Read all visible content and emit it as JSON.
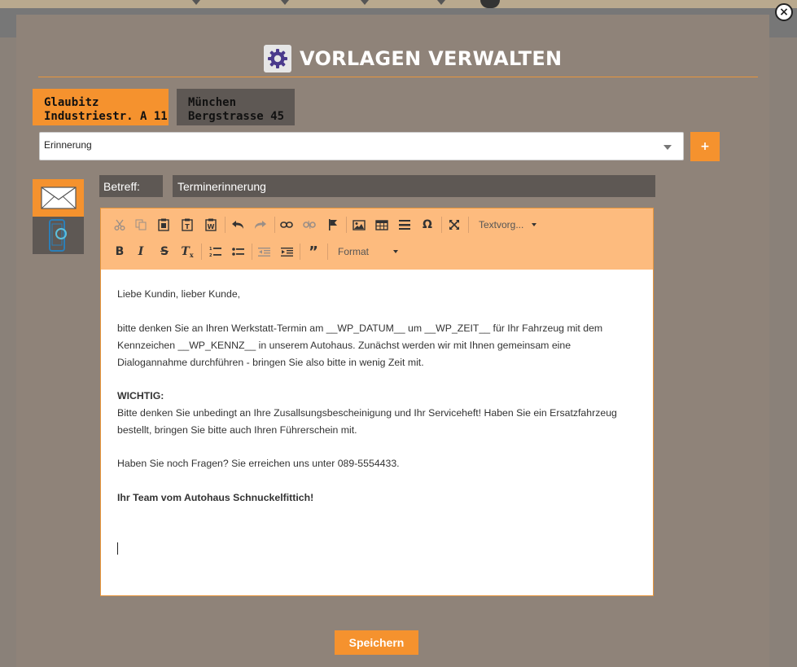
{
  "modal": {
    "title": "VORLAGEN VERWALTEN",
    "close_label": "×"
  },
  "location_tabs": [
    {
      "line1": "Glaubitz",
      "line2": "Industriestr. A 11",
      "active": true
    },
    {
      "line1": "München",
      "line2": "Bergstrasse 45",
      "active": false
    }
  ],
  "template_select": {
    "value": "Erinnerung"
  },
  "add_button": {
    "label": "+"
  },
  "channels": [
    {
      "icon": "envelope-icon",
      "active": true
    },
    {
      "icon": "smartphone-icon",
      "active": false
    }
  ],
  "subject": {
    "label": "Betreff:",
    "value": "Terminerinnerung"
  },
  "toolbar": {
    "row1": [
      "cut-icon",
      "copy-icon",
      "paste-icon",
      "paste-text-icon",
      "paste-word-icon",
      "undo-icon",
      "redo-icon",
      "link-icon",
      "unlink-icon",
      "anchor-flag-icon",
      "image-icon",
      "table-icon",
      "horizontal-rule-icon",
      "special-char-icon",
      "maximize-icon"
    ],
    "textvorlagen_label": "Textvorg...",
    "row2": [
      "bold-icon",
      "italic-icon",
      "strikethrough-icon",
      "remove-format-icon",
      "numbered-list-icon",
      "bullet-list-icon",
      "outdent-icon",
      "indent-icon",
      "blockquote-icon"
    ],
    "format_label": "Format"
  },
  "body": {
    "greeting": "Liebe Kundin, lieber Kunde,",
    "paragraph1": "bitte denken Sie an Ihren Werkstatt-Termin am __WP_DATUM__ um __WP_ZEIT__ für Ihr Fahrzeug mit dem Kennzeichen __WP_KENNZ__ in unserem Autohaus. Zunächst werden wir mit Ihnen gemeinsam eine Dialogannahme durchführen - bringen Sie also bitte in wenig Zeit mit.",
    "important_heading": "WICHTIG:",
    "important_text": "Bitte denken Sie unbedingt an Ihre Zusallsungsbescheinigung und Ihr Serviceheft! Haben Sie ein Ersatzfahrzeug bestellt, bringen Sie bitte auch Ihren Führerschein mit.",
    "questions": "Haben Sie noch Fragen? Sie erreichen uns unter 089-5554433.",
    "signature": "Ihr Team vom Autohaus Schnuckelfittich!"
  },
  "save_button": {
    "label": "Speichern"
  },
  "colors": {
    "accent": "#f5922e",
    "modal_bg": "#8f8379",
    "dark_tab": "#5e5854",
    "toolbar_bg": "#fdbb7e"
  }
}
